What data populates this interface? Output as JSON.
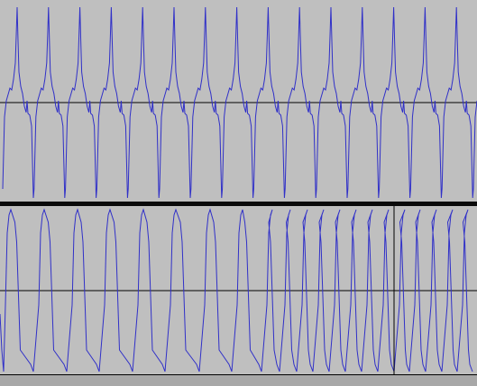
{
  "colors": {
    "background": "#bfbfbf",
    "waveform": "#3030c8",
    "center_line": "#000000",
    "separator": "#000000",
    "scroll_area": "#a8a8a8"
  },
  "tracks": [
    {
      "id": "top",
      "waveform_type": "peaked-pulse",
      "cycles": 15
    },
    {
      "id": "bottom",
      "waveform_type": "square-like",
      "cycles": 20,
      "cycle_spacing_changes": true
    }
  ]
}
